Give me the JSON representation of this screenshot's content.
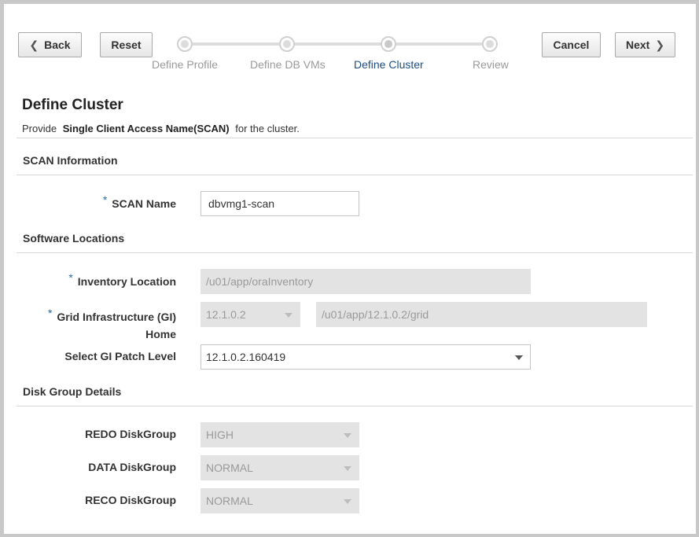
{
  "toolbar": {
    "back_label": "Back",
    "reset_label": "Reset",
    "cancel_label": "Cancel",
    "next_label": "Next"
  },
  "train": {
    "steps": [
      {
        "label": "Define Profile",
        "state": "visited"
      },
      {
        "label": "Define DB VMs",
        "state": "visited"
      },
      {
        "label": "Define Cluster",
        "state": "current"
      },
      {
        "label": "Review",
        "state": "unvisited"
      }
    ]
  },
  "page": {
    "title": "Define Cluster",
    "subtitle_prefix": "Provide",
    "subtitle_bold": "Single Client Access Name(SCAN)",
    "subtitle_suffix": "for the cluster."
  },
  "scan_section": {
    "title": "SCAN Information",
    "scan_name_label": "SCAN Name",
    "scan_name_value": "dbvmg1-scan"
  },
  "software_section": {
    "title": "Software Locations",
    "inventory_label": "Inventory Location",
    "inventory_value": "/u01/app/oraInventory",
    "gi_home_label_line1": "Grid Infrastructure (GI)",
    "gi_home_label_line2": "Home",
    "gi_version_value": "12.1.0.2",
    "gi_path_value": "/u01/app/12.1.0.2/grid",
    "patch_label": "Select GI Patch Level",
    "patch_value": "12.1.0.2.160419"
  },
  "disk_section": {
    "title": "Disk Group Details",
    "redo_label": "REDO DiskGroup",
    "redo_value": "HIGH",
    "data_label": "DATA DiskGroup",
    "data_value": "NORMAL",
    "reco_label": "RECO DiskGroup",
    "reco_value": "NORMAL"
  },
  "required_marker": "*",
  "colors": {
    "accent": "#1b4f8a",
    "required": "#2b6cb0",
    "disabled_bg": "#e3e3e3"
  }
}
